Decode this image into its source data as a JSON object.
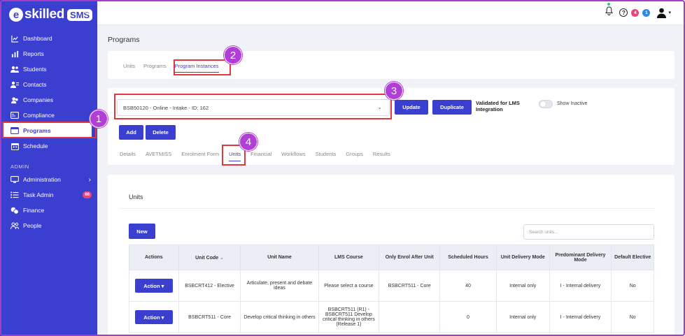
{
  "brand": {
    "logo_letter": "e",
    "logo_text": "skilled",
    "logo_badge": "SMS",
    "collapse_glyph": "«"
  },
  "sidebar": {
    "items": [
      {
        "label": "Dashboard",
        "icon": "chart-line-icon"
      },
      {
        "label": "Reports",
        "icon": "bar-chart-icon"
      },
      {
        "label": "Students",
        "icon": "users-icon"
      },
      {
        "label": "Contacts",
        "icon": "contacts-icon"
      },
      {
        "label": "Companies",
        "icon": "building-icon"
      },
      {
        "label": "Compliance",
        "icon": "id-card-icon"
      },
      {
        "label": "Programs",
        "icon": "window-icon",
        "active": true
      },
      {
        "label": "Schedule",
        "icon": "calendar-icon"
      }
    ],
    "section_label": "ADMIN",
    "admin_items": [
      {
        "label": "Administration",
        "icon": "monitor-icon",
        "chevron": "›"
      },
      {
        "label": "Task Admin",
        "icon": "list-icon",
        "badge": "66"
      },
      {
        "label": "Finance",
        "icon": "coins-icon"
      },
      {
        "label": "People",
        "icon": "people-icon"
      }
    ]
  },
  "topbar": {
    "badge_red": "4",
    "badge_blue": "1",
    "help_glyph": "?",
    "dropdown_glyph": "▾"
  },
  "page": {
    "title": "Programs"
  },
  "top_tabs": [
    {
      "label": "Units"
    },
    {
      "label": "Programs"
    },
    {
      "label": "Program Instances",
      "active": true
    }
  ],
  "instance": {
    "selected": "BSB50120 - Online - Intake - ID: 162",
    "update_label": "Update",
    "duplicate_label": "Duplicate",
    "validated_label": "Validated for LMS Integration",
    "show_inactive_label": "Show Inactive",
    "add_label": "Add",
    "delete_label": "Delete"
  },
  "sub_tabs": [
    {
      "label": "Details"
    },
    {
      "label": "AVETMISS"
    },
    {
      "label": "Enrolment Form"
    },
    {
      "label": "Units",
      "active": true
    },
    {
      "label": "Financial"
    },
    {
      "label": "Workflows"
    },
    {
      "label": "Students"
    },
    {
      "label": "Groups"
    },
    {
      "label": "Results"
    }
  ],
  "units": {
    "title": "Units",
    "new_label": "New",
    "search_placeholder": "Search units...",
    "sort_glyph": "⌄",
    "columns": [
      "Actions",
      "Unit Code",
      "Unit Name",
      "LMS Course",
      "Only Enrol After Unit",
      "Scheduled Hours",
      "Unit Delivery Mode",
      "Predominant Delivery Mode",
      "Default Elective"
    ],
    "rows": [
      {
        "action": "Action",
        "code": "BSBCRT412 - Elective",
        "name": "Articulate, present and debate ideas",
        "lms": "Please select a course",
        "after": "BSBCRT511 - Core",
        "hours": "40",
        "delivery": "Internal only",
        "predominant": "I - Internal delivery",
        "elective": "No"
      },
      {
        "action": "Action",
        "code": "BSBCRT511 - Core",
        "name": "Develop critical thinking in others",
        "lms": "BSBCRT511 (R1) - BSBCRT511 Develop critical thinking in others (Release 1)",
        "after": "",
        "hours": "0",
        "delivery": "Internal only",
        "predominant": "I - Internal delivery",
        "elective": "No"
      }
    ]
  },
  "callouts": [
    "1",
    "2",
    "3",
    "4"
  ],
  "colors": {
    "brand": "#3b3fd0",
    "highlight": "#e0383e",
    "callout": "#b13ed6"
  }
}
